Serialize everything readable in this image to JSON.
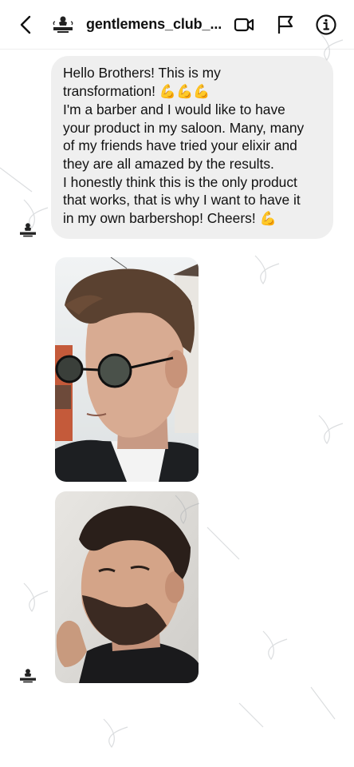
{
  "header": {
    "username": "gentlemens_club_...",
    "back_icon": "chevron-left-icon",
    "video_icon": "video-camera-icon",
    "flag_icon": "flag-icon",
    "info_icon": "info-icon"
  },
  "message": {
    "lines": [
      "Hello Brothers! This is my",
      "transformation!",
      "I'm a barber and I would like to have",
      "your product in my saloon. Many, many",
      "of my friends have tried your elixir and",
      "they are all amazed by the results.",
      "I honestly think this is the only product",
      "that works, that is why I want to have it",
      "in my own barbershop! Cheers!"
    ],
    "emoji_line2": "💪💪💪",
    "emoji_end": "💪"
  },
  "photos": [
    {
      "name": "transformation-photo-1"
    },
    {
      "name": "transformation-photo-2"
    }
  ],
  "colors": {
    "bubble": "#efefef",
    "text": "#111111",
    "border": "#eeeeee"
  }
}
